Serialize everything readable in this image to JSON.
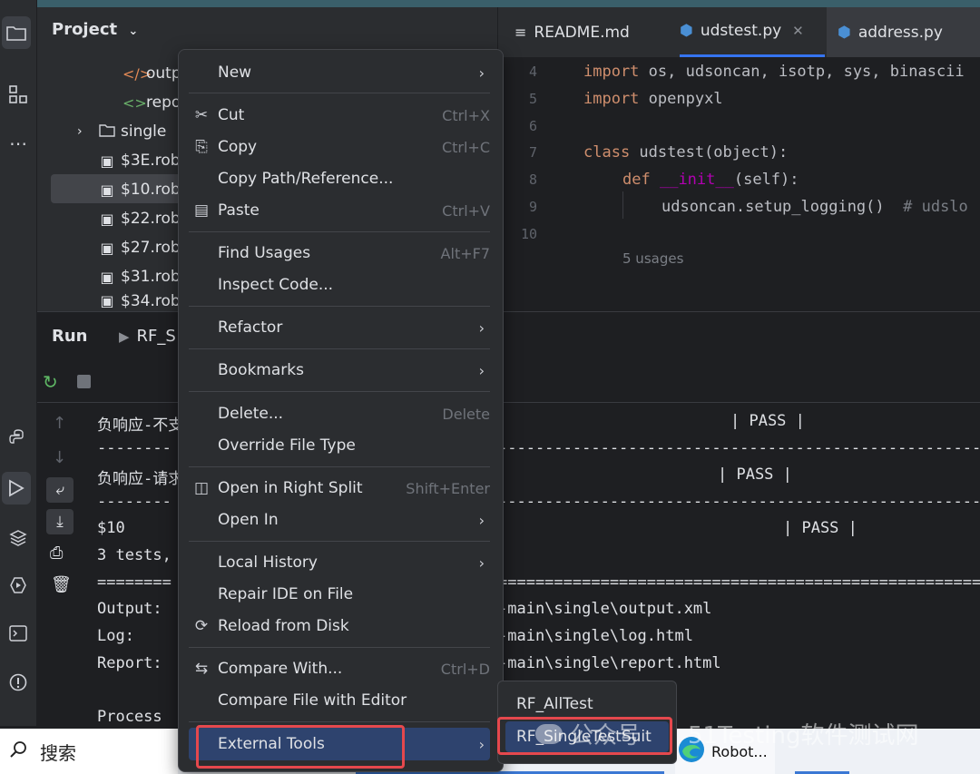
{
  "project_panel": {
    "title": "Project",
    "tree": [
      {
        "label": "outp",
        "icon": "html-icon"
      },
      {
        "label": "repo",
        "icon": "xml-icon"
      },
      {
        "label": "single",
        "icon": "folder-icon"
      },
      {
        "label": "$3E.rob",
        "icon": "robot-icon"
      },
      {
        "label": "$10.rob",
        "icon": "robot-icon"
      },
      {
        "label": "$22.rob",
        "icon": "robot-icon"
      },
      {
        "label": "$27.rob",
        "icon": "robot-icon"
      },
      {
        "label": "$31.rob",
        "icon": "robot-icon"
      },
      {
        "label": "$34.rob",
        "icon": "robot-icon"
      }
    ]
  },
  "editor": {
    "tabs": [
      {
        "label": "README.md"
      },
      {
        "label": "udstest.py"
      },
      {
        "label": "address.py"
      }
    ],
    "line_numbers": [
      "4",
      "5",
      "6",
      "7",
      "8",
      "9",
      "10"
    ],
    "code": {
      "l4_kw": "import",
      "l4_rest": " os, udsoncan, isotp, sys, binascii",
      "l5_kw": "import",
      "l5_rest": " openpyxl",
      "l7_kw": "class",
      "l7_rest": " udstest(object):",
      "l8_kw": "def",
      "l8_fn": "__init__",
      "l8_rest": "(self):",
      "l9_code": "udsoncan.setup_logging()",
      "l9_cmt": "# udslo",
      "usages": "5 usages"
    }
  },
  "run_panel": {
    "title": "Run",
    "config": "RF_S",
    "lines": [
      {
        "left": "负响应-不支",
        "right": "| PASS |"
      },
      {
        "left": "--------",
        "right": "-----------------------------------------------------"
      },
      {
        "left": "负响应-请求",
        "right": "| PASS |"
      },
      {
        "left": "--------",
        "right": "-----------------------------------------------------"
      },
      {
        "left": "$10",
        "right": "| PASS |"
      },
      {
        "left": "3 tests,",
        "right": ""
      },
      {
        "left": "========",
        "right": "====================================================="
      },
      {
        "left": "Output:",
        "right": "-main\\single\\output.xml"
      },
      {
        "left": "Log:",
        "right": "-main\\single\\log.html"
      },
      {
        "left": "Report:",
        "right": "-main\\single\\report.html"
      },
      {
        "left": "",
        "right": ""
      },
      {
        "left": "Process",
        "right": ""
      }
    ]
  },
  "context_menu": {
    "items": [
      {
        "label": "New",
        "shortcut": "",
        "submenu": true,
        "icon": ""
      },
      {
        "label": "Cut",
        "shortcut": "Ctrl+X",
        "submenu": false,
        "icon": "✂"
      },
      {
        "label": "Copy",
        "shortcut": "Ctrl+C",
        "submenu": false,
        "icon": "⎘"
      },
      {
        "label": "Copy Path/Reference...",
        "shortcut": "",
        "submenu": false,
        "icon": ""
      },
      {
        "label": "Paste",
        "shortcut": "Ctrl+V",
        "submenu": false,
        "icon": "📋"
      },
      {
        "label": "Find Usages",
        "shortcut": "Alt+F7",
        "submenu": false,
        "icon": ""
      },
      {
        "label": "Inspect Code...",
        "shortcut": "",
        "submenu": false,
        "icon": ""
      },
      {
        "label": "Refactor",
        "shortcut": "",
        "submenu": true,
        "icon": ""
      },
      {
        "label": "Bookmarks",
        "shortcut": "",
        "submenu": true,
        "icon": ""
      },
      {
        "label": "Delete...",
        "shortcut": "Delete",
        "submenu": false,
        "icon": ""
      },
      {
        "label": "Override File Type",
        "shortcut": "",
        "submenu": false,
        "icon": ""
      },
      {
        "label": "Open in Right Split",
        "shortcut": "Shift+Enter",
        "submenu": false,
        "icon": "◫"
      },
      {
        "label": "Open In",
        "shortcut": "",
        "submenu": true,
        "icon": ""
      },
      {
        "label": "Local History",
        "shortcut": "",
        "submenu": true,
        "icon": ""
      },
      {
        "label": "Repair IDE on File",
        "shortcut": "",
        "submenu": false,
        "icon": ""
      },
      {
        "label": "Reload from Disk",
        "shortcut": "",
        "submenu": false,
        "icon": "⟳"
      },
      {
        "label": "Compare With...",
        "shortcut": "Ctrl+D",
        "submenu": false,
        "icon": "⇆"
      },
      {
        "label": "Compare File with Editor",
        "shortcut": "",
        "submenu": false,
        "icon": ""
      },
      {
        "label": "External Tools",
        "shortcut": "",
        "submenu": true,
        "icon": ""
      }
    ]
  },
  "external_tools_submenu": {
    "items": [
      {
        "label": "RF_AllTest"
      },
      {
        "label": "RF_SingleTestSuit"
      }
    ]
  },
  "taskbar": {
    "search_label": "搜索",
    "app_label": "Robot..."
  },
  "watermark": {
    "left": "公众号",
    "right": "51Testing软件测试网"
  },
  "colors": {
    "highlight_box": "#e5484d",
    "selected_item": "#2e436e",
    "menu_bg": "#2b2d30"
  }
}
